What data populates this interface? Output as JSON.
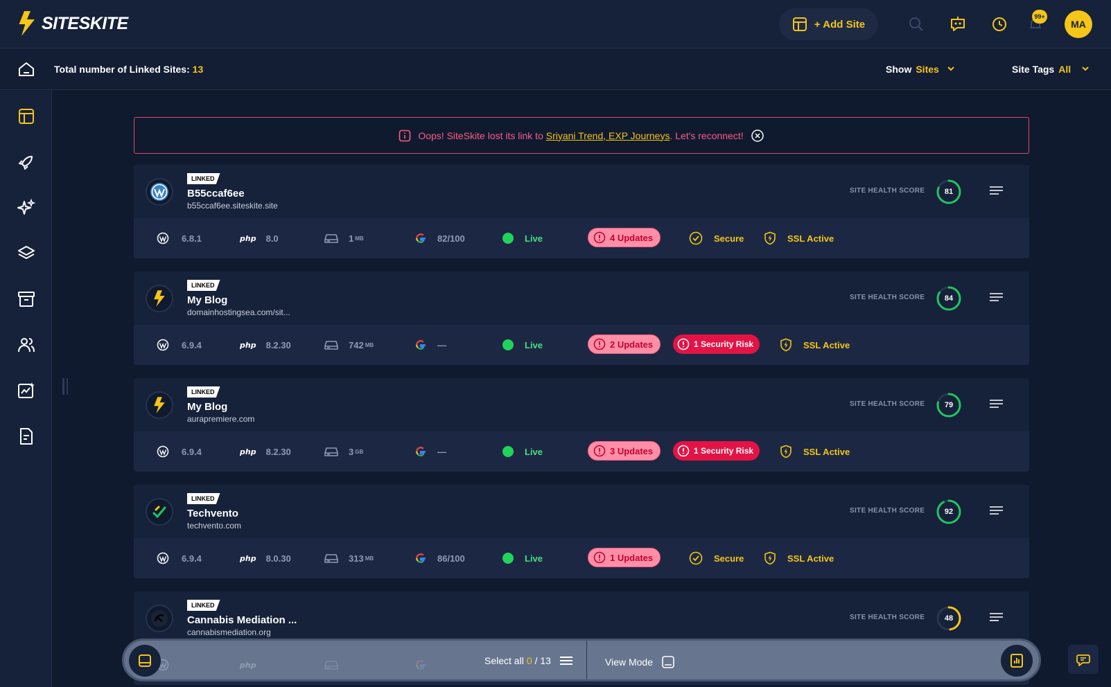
{
  "brand": {
    "name": "SITESKITE"
  },
  "header": {
    "add_site_label": "+ Add Site",
    "notification_count": "99+",
    "avatar_initials": "MA"
  },
  "subheader": {
    "linked_label": "Total number of Linked Sites:",
    "linked_count": "13",
    "show_label": "Show",
    "show_value": "Sites",
    "tags_label": "Site Tags",
    "tags_value": "All"
  },
  "alert": {
    "prefix": "Oops! SiteSkite lost its link to ",
    "sites": "Sriyani Trend, EXP Journeys",
    "suffix": ". Let's reconnect!"
  },
  "health_label": "SITE HEALTH SCORE",
  "sites": [
    {
      "badge": "LINKED",
      "name": "B55ccaf6ee",
      "url": "b55ccaf6ee.siteskite.site",
      "logo": "wordpress",
      "score": "81",
      "score_pct": 0.81,
      "score_color": "#22c55e",
      "wp": "6.8.1",
      "php": "8.0",
      "disk": "1",
      "disk_unit": "MB",
      "google": "82/100",
      "status": "Live",
      "updates": "4 Updates",
      "security": "Secure",
      "security_risk": false,
      "ssl": "SSL Active"
    },
    {
      "badge": "LINKED",
      "name": "My Blog",
      "url": "domainhostingsea.com/sit...",
      "logo": "siteskite",
      "score": "84",
      "score_pct": 0.84,
      "score_color": "#22c55e",
      "wp": "6.9.4",
      "php": "8.2.30",
      "disk": "742",
      "disk_unit": "MB",
      "google": "—",
      "status": "Live",
      "updates": "2 Updates",
      "security": "1 Security Risk",
      "security_risk": true,
      "ssl": "SSL Active"
    },
    {
      "badge": "LINKED",
      "name": "My Blog",
      "url": "aurapremiere.com",
      "logo": "siteskite",
      "score": "79",
      "score_pct": 0.79,
      "score_color": "#22c55e",
      "wp": "6.9.4",
      "php": "8.2.30",
      "disk": "3",
      "disk_unit": "GB",
      "google": "—",
      "status": "Live",
      "updates": "3 Updates",
      "security": "1 Security Risk",
      "security_risk": true,
      "ssl": "SSL Active"
    },
    {
      "badge": "LINKED",
      "name": "Techvento",
      "url": "techvento.com",
      "logo": "techvento",
      "score": "92",
      "score_pct": 0.92,
      "score_color": "#22c55e",
      "wp": "6.9.4",
      "php": "8.0.30",
      "disk": "313",
      "disk_unit": "MB",
      "google": "86/100",
      "status": "Live",
      "updates": "1 Updates",
      "security": "Secure",
      "security_risk": false,
      "ssl": "SSL Active"
    },
    {
      "badge": "LINKED",
      "name": "Cannabis Mediation ...",
      "url": "cannabismediation.org",
      "logo": "cannabis",
      "score": "48",
      "score_pct": 0.48,
      "score_color": "#f5c518",
      "wp": "",
      "php": "",
      "disk": "",
      "disk_unit": "",
      "google": "",
      "status": "",
      "updates": "",
      "security": "",
      "security_risk": false,
      "ssl": ""
    }
  ],
  "bottom_bar": {
    "select_all_label": "Select all",
    "selected_count": "0",
    "total_count": "/ 13",
    "view_mode_label": "View Mode"
  },
  "colors": {
    "accent": "#f5c518",
    "background": "#0f1a2e",
    "card": "#16213a",
    "danger": "#e31346",
    "success": "#22c55e"
  }
}
